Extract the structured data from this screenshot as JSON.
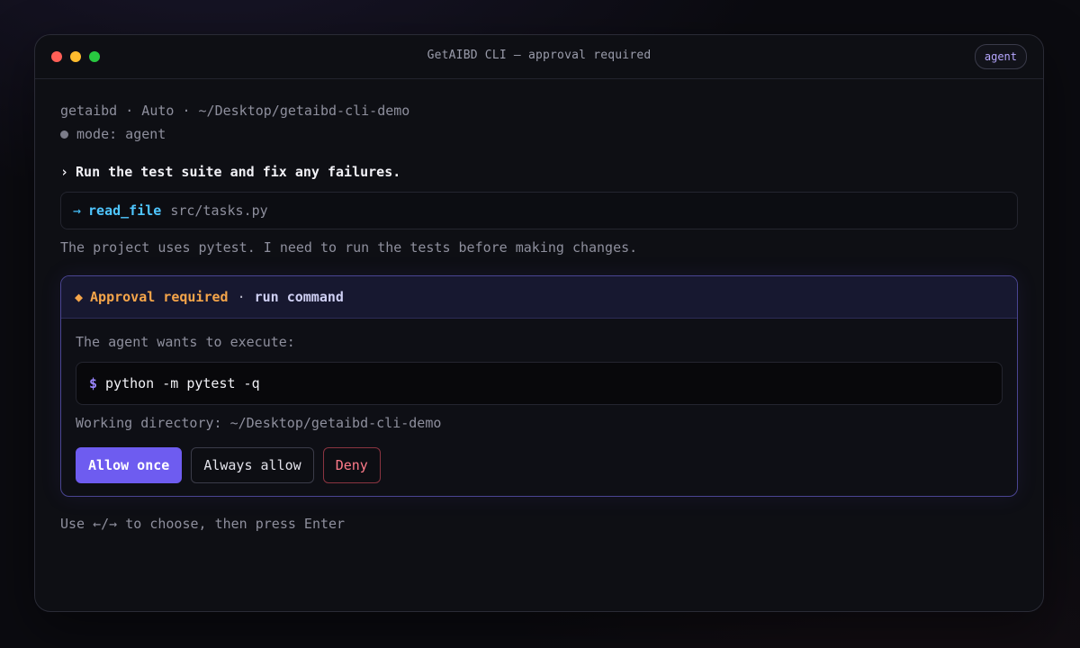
{
  "window": {
    "title": "GetAIBD CLI — approval required",
    "mode_chip": "agent"
  },
  "session": {
    "meta": "getaibd · Auto · ~/Desktop/getaibd-cli-demo",
    "mode": "mode: agent"
  },
  "prompt": {
    "chevron": "›",
    "text": "Run the test suite and fix any failures."
  },
  "tool_call": {
    "arrow": "→",
    "name": "read_file",
    "arg": "src/tasks.py"
  },
  "assistant_note": "The project uses pytest. I need to run the tests before making changes.",
  "approval": {
    "icon": "◆",
    "title": "Approval required",
    "separator": "·",
    "action": "run command",
    "wants": "The agent wants to execute:",
    "prompt_symbol": "$",
    "command": "python -m pytest -q",
    "working_directory": "Working directory: ~/Desktop/getaibd-cli-demo",
    "buttons": {
      "allow_once": "Allow once",
      "always_allow": "Always allow",
      "deny": "Deny"
    }
  },
  "hint": "Use ←/→ to choose, then press Enter",
  "colors": {
    "accent": "#6e5cf0",
    "warning": "#f5a54a",
    "tool": "#4fc6ff",
    "deny": "#ff7b8a"
  }
}
